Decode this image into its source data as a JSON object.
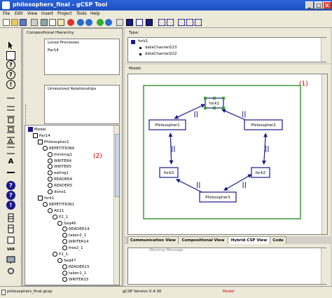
{
  "window": {
    "title": "philosophers_final - gCSP Tool"
  },
  "menu": [
    "File",
    "Edit",
    "View",
    "Insert",
    "Project",
    "Tools",
    "Help"
  ],
  "hierarchy": {
    "title": "Compositional Hierarchy",
    "loose_title": "Loose Processes",
    "loose_items": [
      "Par14"
    ],
    "unresolved_title": "Unresolved Relationships"
  },
  "tree": [
    {
      "depth": 0,
      "label": "Model"
    },
    {
      "depth": 1,
      "label": "Par14"
    },
    {
      "depth": 2,
      "label": "Philosopher1"
    },
    {
      "depth": 3,
      "label": "REPETITION4"
    },
    {
      "depth": 4,
      "label": "thinking1"
    },
    {
      "depth": 4,
      "label": "WRITER4"
    },
    {
      "depth": 4,
      "label": "WRITER5"
    },
    {
      "depth": 4,
      "label": "eating1"
    },
    {
      "depth": 4,
      "label": "READER4"
    },
    {
      "depth": 4,
      "label": "READER5"
    },
    {
      "depth": 4,
      "label": "done1"
    },
    {
      "depth": 2,
      "label": "fork1"
    },
    {
      "depth": 3,
      "label": "REPETITION1"
    },
    {
      "depth": 4,
      "label": "Alt11"
    },
    {
      "depth": 5,
      "label": "P2_1"
    },
    {
      "depth": 6,
      "label": "Seq46"
    },
    {
      "depth": 7,
      "label": "READER14"
    },
    {
      "depth": 7,
      "label": "taken2_1"
    },
    {
      "depth": 7,
      "label": "WRITER14"
    },
    {
      "depth": 7,
      "label": "free2_1"
    },
    {
      "depth": 5,
      "label": "P1_1"
    },
    {
      "depth": 6,
      "label": "Seq47"
    },
    {
      "depth": 7,
      "label": "READER15"
    },
    {
      "depth": 7,
      "label": "taken1_1"
    },
    {
      "depth": 7,
      "label": "WRITER15"
    }
  ],
  "annotations": {
    "left": "(2)",
    "right": "(1)"
  },
  "type_panel": {
    "title": "Type:",
    "root": "fork1",
    "children": [
      "dataChannel223",
      "dataChannel222"
    ]
  },
  "model_panel": {
    "title": "Model:"
  },
  "diagram": {
    "nodes": [
      {
        "id": "fork1",
        "label": "fork1",
        "selected": true
      },
      {
        "id": "phil1",
        "label": "Philosopher1"
      },
      {
        "id": "phil2",
        "label": "Philosopher2"
      },
      {
        "id": "fork3",
        "label": "fork3"
      },
      {
        "id": "fork2",
        "label": "fork2"
      },
      {
        "id": "phil3",
        "label": "Philosopher3"
      }
    ],
    "parallel_symbol": "||"
  },
  "tabs": [
    {
      "label": "Communication View",
      "active": false
    },
    {
      "label": "Compositional View",
      "active": false
    },
    {
      "label": "Hybrid CSP View",
      "active": true
    },
    {
      "label": "Code",
      "active": false
    }
  ],
  "warning": {
    "title": "Warning Message"
  },
  "status": {
    "file": "philosophers_final.gcsp",
    "version": "gCSP Version 0.4.30",
    "mode": "Model"
  },
  "lefttools_label": "VAR",
  "colors": {
    "accent": "#1f4fbf",
    "diagram_border": "#3a9a3a",
    "node_border": "#1a1a8c",
    "annotation": "#d00000"
  }
}
